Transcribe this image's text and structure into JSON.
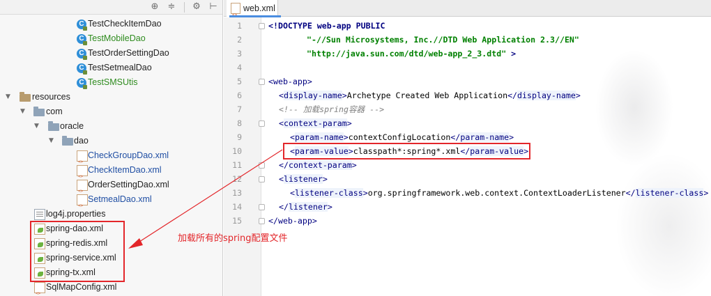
{
  "tree": {
    "rows": [
      {
        "label": "TestCheckItemDao",
        "kind": "class",
        "color": "default"
      },
      {
        "label": "TestMobileDao",
        "kind": "class",
        "color": "green"
      },
      {
        "label": "TestOrderSettingDao",
        "kind": "class",
        "color": "default"
      },
      {
        "label": "TestSetmealDao",
        "kind": "class",
        "color": "default"
      },
      {
        "label": "TestSMSUtis",
        "kind": "class",
        "color": "green"
      },
      {
        "label": "resources",
        "kind": "resource-folder",
        "expanded": true
      },
      {
        "label": "com",
        "kind": "folder",
        "expanded": true
      },
      {
        "label": "oracle",
        "kind": "folder",
        "expanded": true
      },
      {
        "label": "dao",
        "kind": "folder",
        "expanded": true
      },
      {
        "label": "CheckGroupDao.xml",
        "kind": "xml",
        "color": "blue"
      },
      {
        "label": "CheckItemDao.xml",
        "kind": "xml",
        "color": "blue"
      },
      {
        "label": "OrderSettingDao.xml",
        "kind": "xml",
        "color": "default"
      },
      {
        "label": "SetmealDao.xml",
        "kind": "xml",
        "color": "blue"
      },
      {
        "label": "log4j.properties",
        "kind": "properties",
        "color": "default"
      },
      {
        "label": "spring-dao.xml",
        "kind": "spring-xml",
        "color": "default"
      },
      {
        "label": "spring-redis.xml",
        "kind": "spring-xml",
        "color": "default"
      },
      {
        "label": "spring-service.xml",
        "kind": "spring-xml",
        "color": "default"
      },
      {
        "label": "spring-tx.xml",
        "kind": "spring-xml",
        "color": "default"
      },
      {
        "label": "SqlMapConfig.xml",
        "kind": "xml",
        "color": "default"
      }
    ]
  },
  "toolbar": {
    "icons": [
      "crosshair-icon",
      "collapse-icon",
      "gear-icon",
      "hide-icon"
    ]
  },
  "editor": {
    "tab_label": "web.xml",
    "line_numbers": [
      "1",
      "2",
      "3",
      "4",
      "5",
      "6",
      "7",
      "8",
      "9",
      "10",
      "11",
      "12",
      "13",
      "14",
      "15"
    ],
    "lines": {
      "l1_decl": "<!DOCTYPE web-app PUBLIC",
      "l2_str": "\"-//Sun Microsystems, Inc.//DTD Web Application 2.3//EN\"",
      "l3_str": "\"http://java.sun.com/dtd/web-app_2_3.dtd\"",
      "l3_end": " >",
      "l5_tag": "web-app",
      "l6_tag": "display-name",
      "l6_text": "Archetype Created Web Application",
      "l7_comment": "<!-- 加载spring容器 -->",
      "l8_tag": "context-param",
      "l9_tag": "param-name",
      "l9_text": "contextConfigLocation",
      "l10_tag": "param-value",
      "l10_text": "classpath*:spring*.xml",
      "l11_tag": "context-param",
      "l12_tag": "listener",
      "l13_tag": "listener-class",
      "l13_text": "org.springframework.web.context.ContextLoaderListener",
      "l14_tag": "listener",
      "l15_tag": "web-app"
    }
  },
  "annotation": {
    "text": "加载所有的spring配置文件",
    "color": "#e3262a"
  }
}
